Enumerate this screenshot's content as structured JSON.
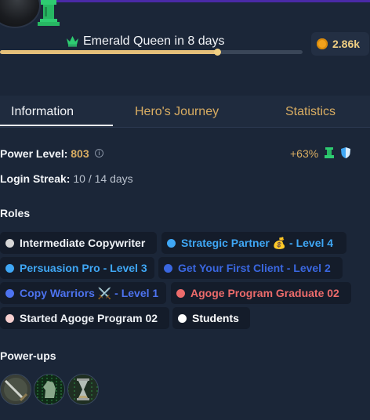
{
  "profile": {
    "next_rank_text": "Emerald Queen in 8 days",
    "rank_progress_fraction": 0.72,
    "coins": "2.86k"
  },
  "tabs": [
    {
      "label": "Information",
      "active": true
    },
    {
      "label": "Hero's Journey",
      "active": false
    },
    {
      "label": "Statistics",
      "active": false
    }
  ],
  "info": {
    "power_level_label": "Power Level:",
    "power_level_value": "803",
    "power_change": "+63%",
    "login_streak_label": "Login Streak:",
    "login_streak_value": "10 / 14 days"
  },
  "roles": {
    "heading": "Roles",
    "items": [
      {
        "label": "Intermediate Copywriter",
        "dot_color": "#d7d7d7",
        "text_color": "#eef1f5"
      },
      {
        "label": "Strategic Partner 💰 - Level 4",
        "dot_color": "#3fa7f5",
        "text_color": "#3fa7f5"
      },
      {
        "label": "Persuasion Pro - Level 3",
        "dot_color": "#3fa7f5",
        "text_color": "#3fa7f5"
      },
      {
        "label": "Get Your First Client - Level 2",
        "dot_color": "#3a67e0",
        "text_color": "#3a67e0"
      },
      {
        "label": "Copy Warriors ⚔️ - Level 1",
        "dot_color": "#4d73f0",
        "text_color": "#4d73f0"
      },
      {
        "label": "Agoge Program Graduate 02",
        "dot_color": "#ec6b6b",
        "text_color": "#ec6b6b"
      },
      {
        "label": "Started Agoge Program 02",
        "dot_color": "#f6cfcf",
        "text_color": "#eef1f5"
      },
      {
        "label": "Students",
        "dot_color": "#ffffff",
        "text_color": "#ffffff"
      }
    ]
  },
  "powerups": {
    "heading": "Power-ups",
    "items": [
      {
        "icon": "sword-powerup-icon"
      },
      {
        "icon": "matrix-knight-powerup-icon"
      },
      {
        "icon": "hourglass-powerup-icon"
      }
    ]
  },
  "colors": {
    "background": "#1b2638",
    "accent_gold": "#d9ad62",
    "rank_green": "#2ecc71"
  }
}
